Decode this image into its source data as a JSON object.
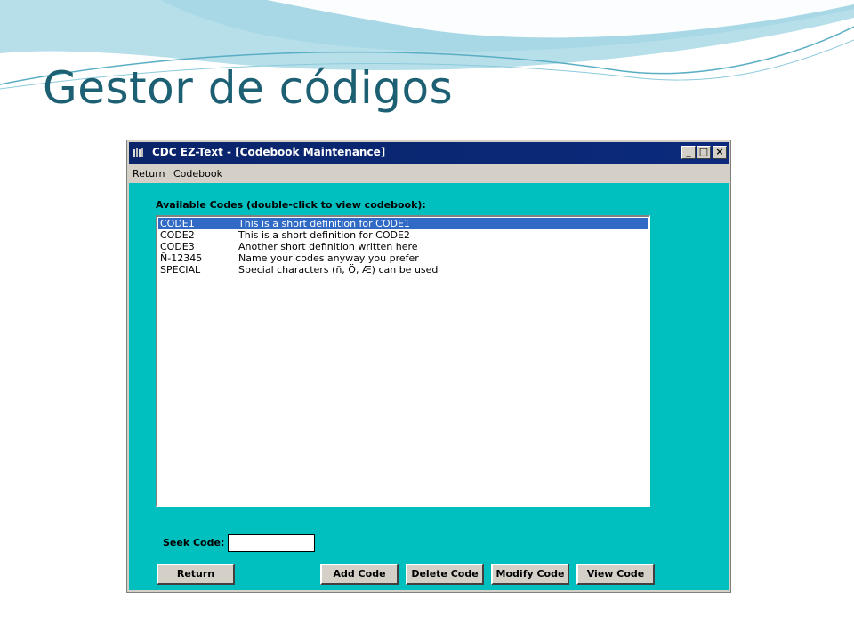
{
  "slide": {
    "title": "Gestor de códigos"
  },
  "window": {
    "title": "CDC EZ-Text - [Codebook Maintenance]",
    "controls": {
      "minimize": "_",
      "maximize": "□",
      "close": "×"
    },
    "menu": [
      "Return",
      "Codebook"
    ]
  },
  "codes": {
    "label": "Available Codes (double-click to view codebook):",
    "items": [
      {
        "code": "CODE1",
        "definition": "This is a short definition for CODE1",
        "selected": true
      },
      {
        "code": "CODE2",
        "definition": "This is a short definition for CODE2",
        "selected": false
      },
      {
        "code": "CODE3",
        "definition": "Another short definition written here",
        "selected": false
      },
      {
        "code": "Ñ-12345",
        "definition": "Name your codes anyway you prefer",
        "selected": false
      },
      {
        "code": "SPECIAL",
        "definition": "Special characters (ñ, Ö, Æ) can be used",
        "selected": false
      }
    ]
  },
  "seek": {
    "label": "Seek Code:",
    "value": ""
  },
  "buttons": {
    "return": "Return",
    "add": "Add Code",
    "delete": "Delete Code",
    "modify": "Modify Code",
    "view": "View Code"
  },
  "colors": {
    "client_bg": "#00bfbf",
    "titlebar": "#0a246a",
    "selection": "#316ac5",
    "slide_title": "#1d6073"
  }
}
